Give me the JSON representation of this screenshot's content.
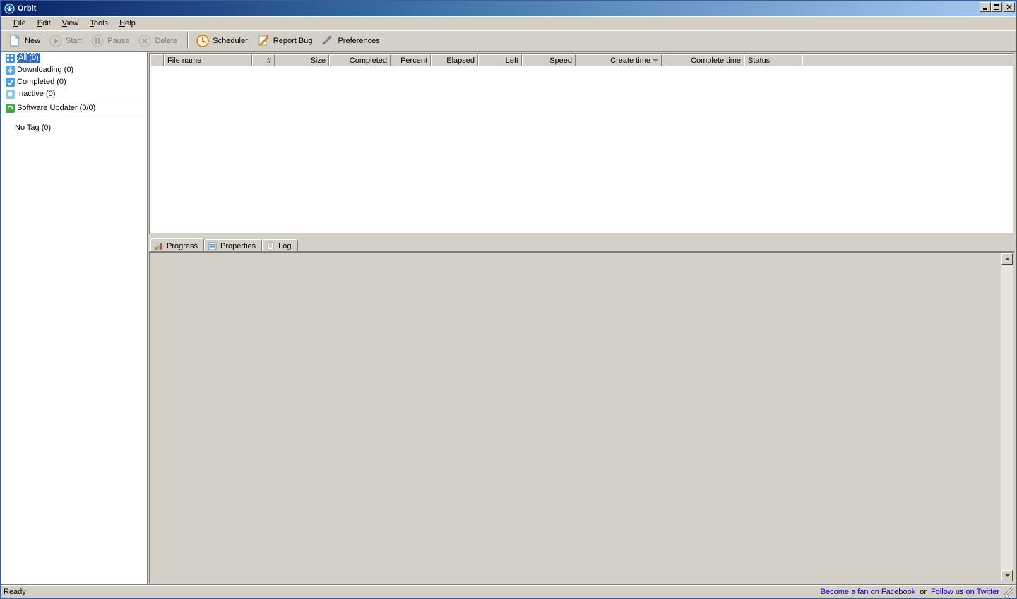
{
  "title": "Orbit",
  "menu": {
    "file": "File",
    "edit": "Edit",
    "view": "View",
    "tools": "Tools",
    "help": "Help"
  },
  "toolbar": {
    "new": "New",
    "start": "Start",
    "pause": "Pause",
    "delete": "Delete",
    "scheduler": "Scheduler",
    "report_bug": "Report Bug",
    "preferences": "Preferences"
  },
  "sidebar": {
    "all": "All (0)",
    "downloading": "Downloading (0)",
    "completed": "Completed (0)",
    "inactive": "Inactive (0)",
    "software_updater": "Software Updater (0/0)",
    "no_tag": "No Tag (0)"
  },
  "columns": {
    "blank": "",
    "filename": "File name",
    "num": "#",
    "size": "Size",
    "completed": "Completed",
    "percent": "Percent",
    "elapsed": "Elapsed",
    "left": "Left",
    "speed": "Speed",
    "create_time": "Create time",
    "complete_time": "Complete time",
    "status": "Status"
  },
  "tabs": {
    "progress": "Progress",
    "properties": "Properties",
    "log": "Log"
  },
  "status": {
    "ready": "Ready",
    "facebook": "Become a fan on Facebook",
    "or": "or",
    "twitter": "Follow us on Twitter"
  }
}
